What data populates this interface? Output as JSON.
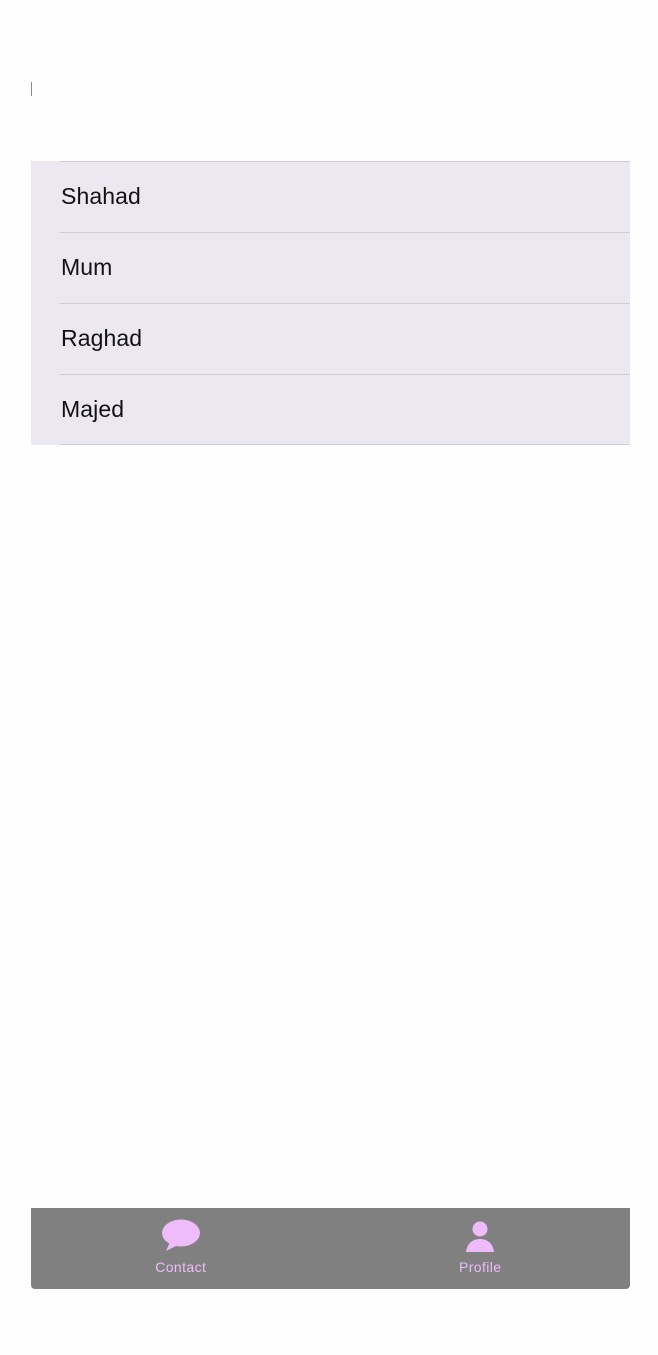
{
  "contacts": [
    {
      "name": "Shahad"
    },
    {
      "name": "Mum"
    },
    {
      "name": "Raghad"
    },
    {
      "name": "Majed"
    }
  ],
  "tab_bar": {
    "tabs": [
      {
        "label": "Contact",
        "icon": "chat-bubble-icon"
      },
      {
        "label": "Profile",
        "icon": "person-icon"
      }
    ]
  },
  "colors": {
    "accent": "#eebcfa",
    "list_background": "#ebe8f2",
    "tab_bar_background": "#808080",
    "separator": "#cfcdd4"
  }
}
